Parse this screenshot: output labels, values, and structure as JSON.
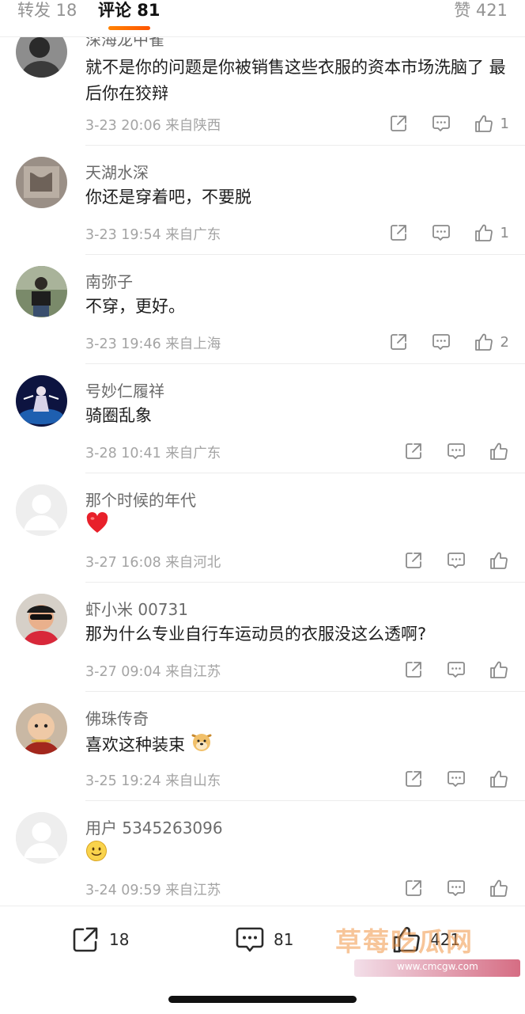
{
  "tabs": {
    "repost": "转发 18",
    "comments": "评论 81",
    "like": "赞 421"
  },
  "comments": [
    {
      "name": "深海龙中雀",
      "text": "就不是你的问题是你被销售这些衣服的资本市场洗脑了 最后你在狡辩",
      "time": "3-23 20:06",
      "location": "来自陕西",
      "likes": "1"
    },
    {
      "name": "天湖水深",
      "text": "你还是穿着吧，不要脱",
      "time": "3-23 19:54",
      "location": "来自广东",
      "likes": "1"
    },
    {
      "name": "南弥子",
      "text": "不穿，更好。",
      "time": "3-23 19:46",
      "location": "来自上海",
      "likes": "2"
    },
    {
      "name": "号妙仁履祥",
      "text": "骑圈乱象",
      "time": "3-28 10:41",
      "location": "来自广东",
      "likes": ""
    },
    {
      "name": "那个时候的年代",
      "text": "",
      "emoji": "heart",
      "time": "3-27 16:08",
      "location": "来自河北",
      "likes": ""
    },
    {
      "name": "虾小米 00731",
      "text": "那为什么专业自行车运动员的衣服没这么透啊?",
      "time": "3-27 09:04",
      "location": "来自江苏",
      "likes": ""
    },
    {
      "name": "佛珠传奇",
      "text": "喜欢这种装束",
      "emoji": "doge",
      "time": "3-25 19:24",
      "location": "来自山东",
      "likes": ""
    },
    {
      "name": "用户 5345263096",
      "text": "",
      "emoji": "smile",
      "time": "3-24 09:59",
      "location": "来自江苏",
      "likes": ""
    }
  ],
  "bottom": {
    "repost_count": "18",
    "comment_count": "81",
    "like_count": "421"
  },
  "watermark": {
    "title": "草莓吃瓜网",
    "url": "www.cmcgw.com"
  },
  "colors": {
    "accent": "#ff8200",
    "heart": "#e8202a",
    "text_secondary": "#a4a4a4"
  }
}
